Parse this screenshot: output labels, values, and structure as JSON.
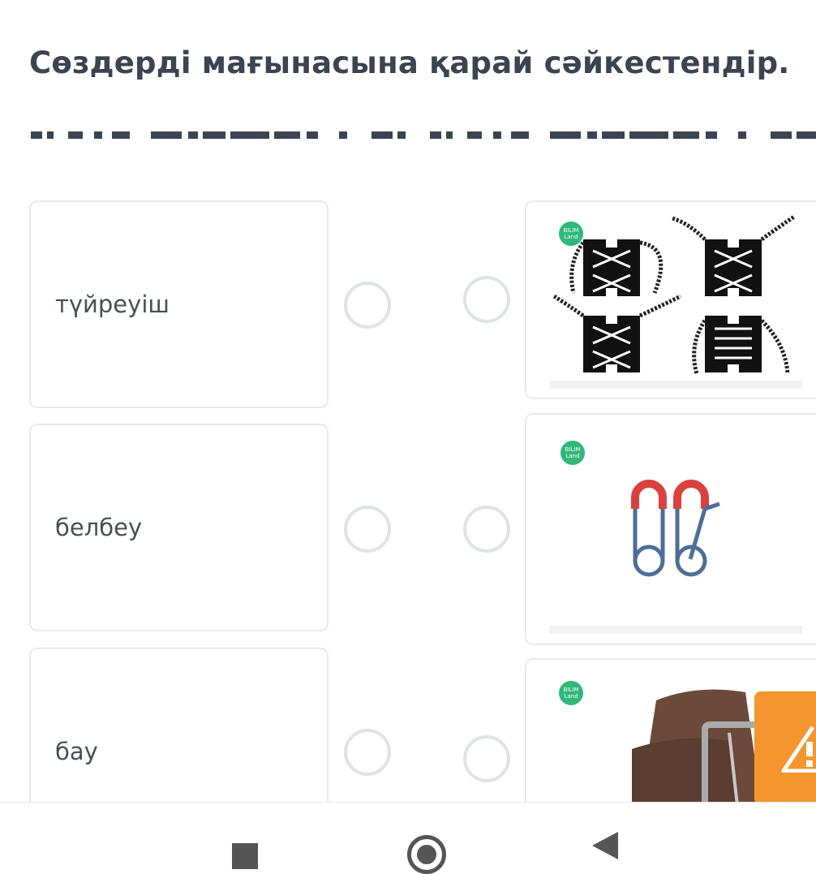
{
  "question": {
    "title": "Сөздерді мағынасына қарай сәйкестендір."
  },
  "words": [
    {
      "label": "түйреуіш"
    },
    {
      "label": "белбеу"
    },
    {
      "label": "бау"
    }
  ],
  "images": [
    {
      "subject": "shoelaces",
      "logo_text": "BILIM Land"
    },
    {
      "subject": "safety-pins",
      "logo_text": "BILIM Land"
    },
    {
      "subject": "belt",
      "logo_text": "BILIM Land"
    }
  ],
  "colors": {
    "title": "#3b4450",
    "card_border": "#e7e9ec",
    "radio_border": "#dfe2e6",
    "logo_green": "#2fb87a",
    "warning_button": "#f4952e"
  },
  "icons": {
    "warning_button": "warning-triangle-icon",
    "nav_recents": "recents-square-icon",
    "nav_home": "home-circle-icon",
    "nav_back": "back-triangle-icon"
  }
}
